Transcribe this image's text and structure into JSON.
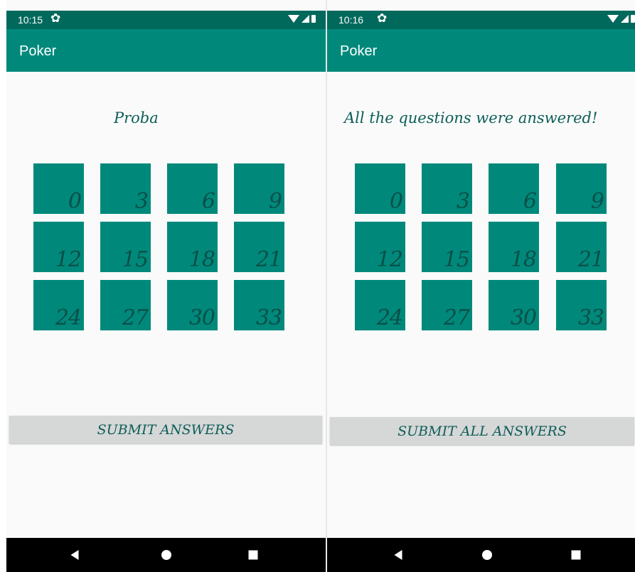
{
  "screens": [
    {
      "status": {
        "time": "10:15"
      },
      "appbar": {
        "title": "Poker"
      },
      "heading": "Proba",
      "tiles": [
        "0",
        "3",
        "6",
        "9",
        "12",
        "15",
        "18",
        "21",
        "24",
        "27",
        "30",
        "33"
      ],
      "submit_label": "SUBMIT ANSWERS"
    },
    {
      "status": {
        "time": "10:16"
      },
      "appbar": {
        "title": "Poker"
      },
      "heading": "All the questions were answered!",
      "tiles": [
        "0",
        "3",
        "6",
        "9",
        "12",
        "15",
        "18",
        "21",
        "24",
        "27",
        "30",
        "33"
      ],
      "submit_label": "SUBMIT ALL ANSWERS"
    }
  ],
  "colors": {
    "status_bar": "#00695c",
    "app_bar": "#00897b",
    "tile": "#00897b",
    "tile_text": "#0a4f48",
    "button_bg": "#d6d7d7",
    "heading_text": "#0d5e58"
  },
  "icons": [
    "gear-icon",
    "wifi-icon",
    "signal-icon",
    "battery-icon",
    "back-icon",
    "home-icon",
    "recent-apps-icon"
  ]
}
